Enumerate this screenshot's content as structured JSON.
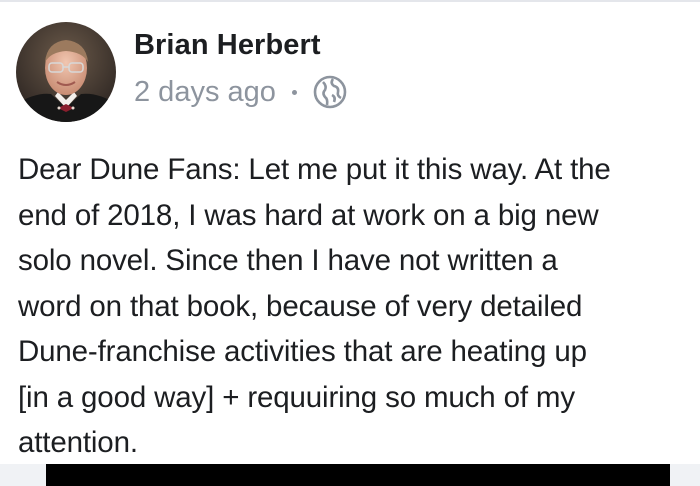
{
  "post": {
    "author_name": "Brian Herbert",
    "timestamp": "2 days ago",
    "privacy_icon": "globe-icon",
    "body_text": "Dear Dune Fans: Let me put it this way. At the\nend of 2018, I was hard at work on a big new\nsolo novel. Since then I have not written a\nword on that book, because of very detailed\nDune-franchise activities that are heating up\n[in a good way] + requuiring so much of my\nattention."
  },
  "colors": {
    "name_text": "#1c1e21",
    "meta_text": "#8d949e",
    "divider": "#e4e6eb"
  }
}
